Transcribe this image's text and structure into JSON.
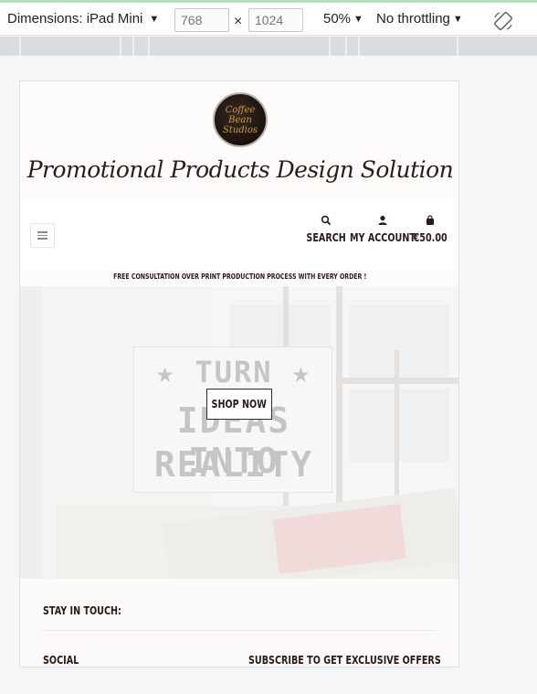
{
  "devtools": {
    "dimensions_label": "Dimensions: iPad Mini",
    "width_value": "768",
    "height_value": "1024",
    "times": "×",
    "zoom": "50%",
    "throttling": "No throttling",
    "rotate_icon": "rotate-icon"
  },
  "site": {
    "logo_text": "Coffee Bean Studios",
    "title": "Promotional Products Design Solution",
    "nav": {
      "menu_icon": "hamburger-icon",
      "search_label": "SEARCH",
      "account_label": "MY ACCOUNT",
      "cart_label": "€50.00"
    },
    "promo_text": "FREE CONSULTATION OVER PRINT PRODUCTION PROCESS WITH EVERY ORDER !",
    "hero": {
      "lightbox_line1": "★ TURN ★",
      "lightbox_line2": "IDEAS INTO",
      "lightbox_line3": "REALITY",
      "button_label": "SHOP NOW"
    },
    "footer": {
      "stay_in_touch": "STAY IN TOUCH:",
      "social": "SOCIAL",
      "subscribe": "SUBSCRIBE TO GET EXCLUSIVE OFFERS"
    }
  },
  "colors": {
    "brand_dark": "#2a1a18",
    "logo_gold": "#c79a4b",
    "devtools_bg": "#ffffff",
    "ruler_bg": "#d9dde0"
  }
}
